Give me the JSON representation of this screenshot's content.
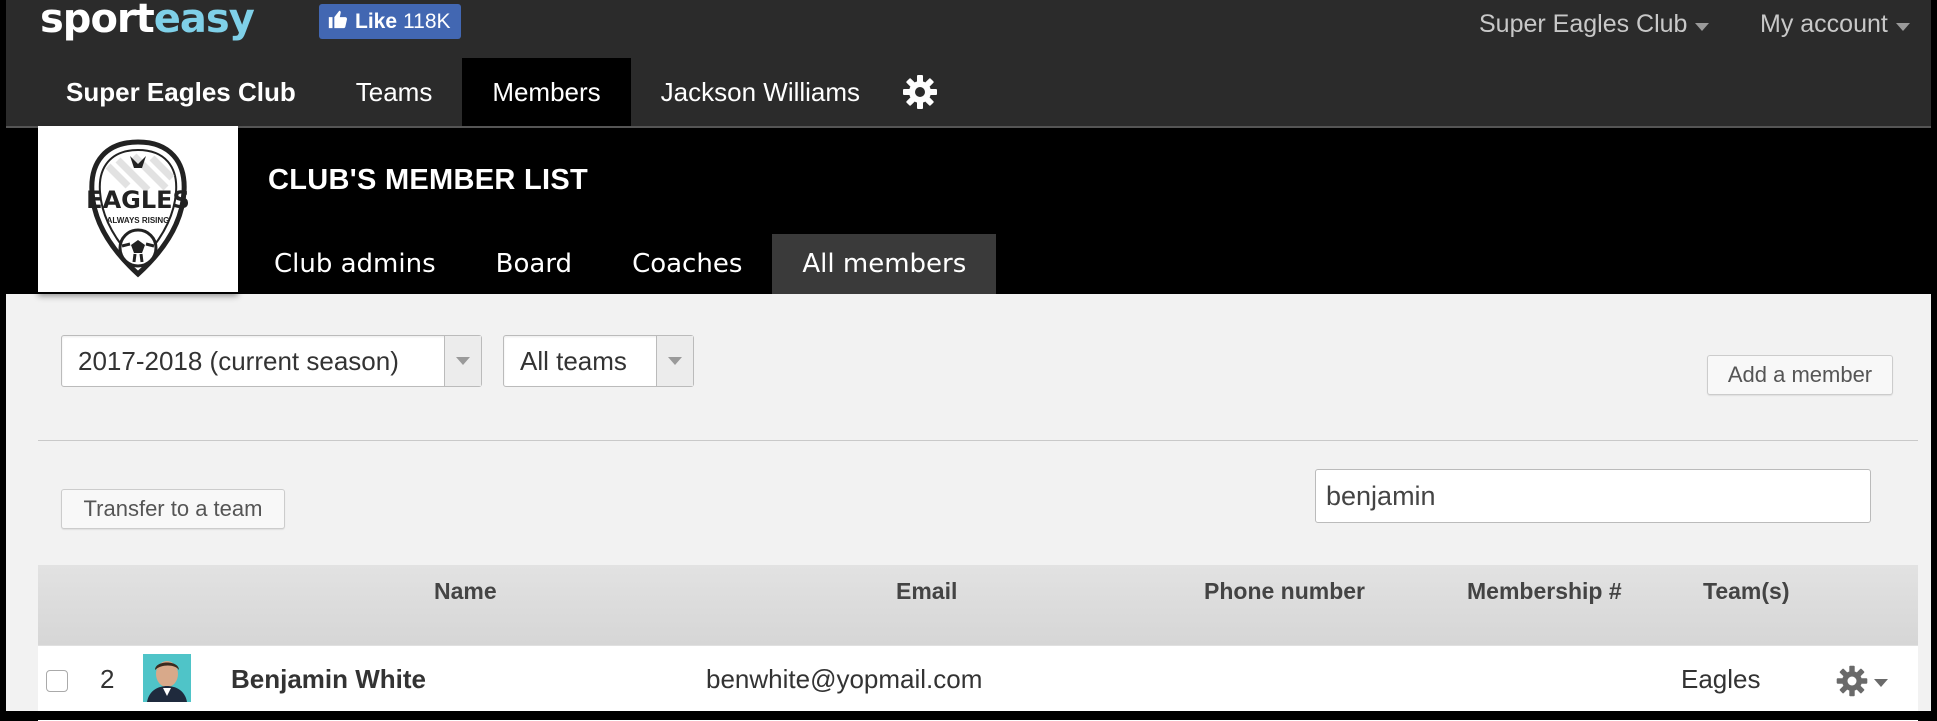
{
  "brand": {
    "logo_a": "sport",
    "logo_b": "easy"
  },
  "facebook": {
    "like_label": "Like",
    "count": "118K"
  },
  "top_right": {
    "club_menu": "Super Eagles Club",
    "account_menu": "My account"
  },
  "nav": {
    "brand": "Super Eagles Club",
    "items": [
      {
        "label": "Teams"
      },
      {
        "label": "Members"
      },
      {
        "label": "Jackson Williams"
      }
    ]
  },
  "header": {
    "title": "CLUB'S MEMBER LIST",
    "crest_text": "EAGLES",
    "crest_subtext": "ALWAYS RISING",
    "subtabs": [
      {
        "label": "Club admins"
      },
      {
        "label": "Board"
      },
      {
        "label": "Coaches"
      },
      {
        "label": "All members"
      }
    ]
  },
  "filters": {
    "season": "2017-2018 (current season)",
    "teams": "All teams"
  },
  "buttons": {
    "add_member": "Add a member",
    "transfer": "Transfer to a team"
  },
  "search": {
    "value": "benjamin"
  },
  "table": {
    "columns": [
      "Name",
      "Email",
      "Phone number",
      "Membership #",
      "Team(s)"
    ],
    "rows": [
      {
        "index": "2",
        "name": "Benjamin White",
        "email": "benwhite@yopmail.com",
        "phone": "",
        "membership": "",
        "teams": "Eagles"
      }
    ]
  },
  "colors": {
    "accent_fb": "#4267b2",
    "nav_bg": "#2b2b2b",
    "header_bg": "#000000",
    "logo_easy": "#7fd0e8"
  }
}
